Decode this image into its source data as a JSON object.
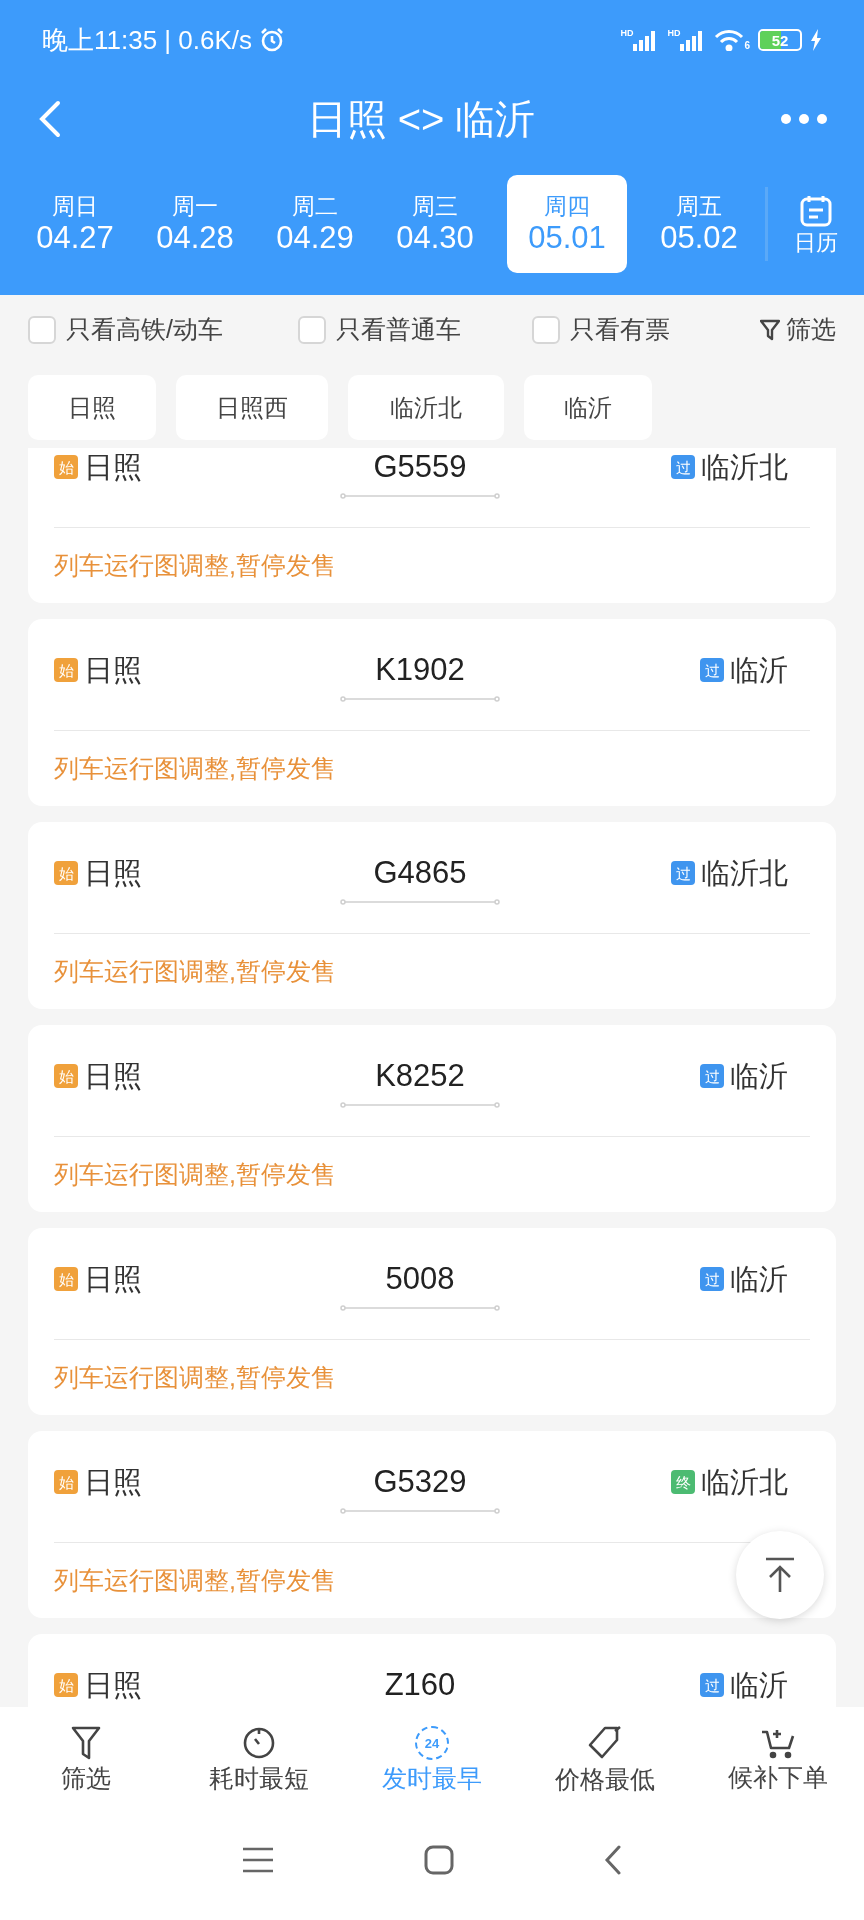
{
  "status_bar": {
    "time": "晚上11:35 | 0.6K/s",
    "signals": [
      {
        "label": "HD"
      },
      {
        "label": "HD"
      }
    ],
    "wifi_label": "6",
    "battery": "52"
  },
  "header": {
    "title": "日照 <> 临沂"
  },
  "dates": [
    {
      "weekday": "周日",
      "date": "04.27",
      "selected": false
    },
    {
      "weekday": "周一",
      "date": "04.28",
      "selected": false
    },
    {
      "weekday": "周二",
      "date": "04.29",
      "selected": false
    },
    {
      "weekday": "周三",
      "date": "04.30",
      "selected": false
    },
    {
      "weekday": "周四",
      "date": "05.01",
      "selected": true
    },
    {
      "weekday": "周五",
      "date": "05.02",
      "selected": false
    }
  ],
  "calendar_button": "日历",
  "filters": [
    {
      "label": "只看高铁/动车",
      "checked": false
    },
    {
      "label": "只看普通车",
      "checked": false
    },
    {
      "label": "只看有票",
      "checked": false
    }
  ],
  "filter_button": "筛选",
  "stations": [
    "日照",
    "日照西",
    "临沂北",
    "临沂"
  ],
  "trains": [
    {
      "from_badge": {
        "text": "始",
        "color": "#f0a13b"
      },
      "from": "日照",
      "number": "G5559",
      "to_badge": {
        "text": "过",
        "color": "#3f95ef"
      },
      "to": "临沂北",
      "status": "列车运行图调整,暂停发售"
    },
    {
      "from_badge": {
        "text": "始",
        "color": "#f0a13b"
      },
      "from": "日照",
      "number": "K1902",
      "to_badge": {
        "text": "过",
        "color": "#3f95ef"
      },
      "to": "临沂",
      "status": "列车运行图调整,暂停发售"
    },
    {
      "from_badge": {
        "text": "始",
        "color": "#f0a13b"
      },
      "from": "日照",
      "number": "G4865",
      "to_badge": {
        "text": "过",
        "color": "#3f95ef"
      },
      "to": "临沂北",
      "status": "列车运行图调整,暂停发售"
    },
    {
      "from_badge": {
        "text": "始",
        "color": "#f0a13b"
      },
      "from": "日照",
      "number": "K8252",
      "to_badge": {
        "text": "过",
        "color": "#3f95ef"
      },
      "to": "临沂",
      "status": "列车运行图调整,暂停发售"
    },
    {
      "from_badge": {
        "text": "始",
        "color": "#f0a13b"
      },
      "from": "日照",
      "number": "5008",
      "to_badge": {
        "text": "过",
        "color": "#3f95ef"
      },
      "to": "临沂",
      "status": "列车运行图调整,暂停发售"
    },
    {
      "from_badge": {
        "text": "始",
        "color": "#f0a13b"
      },
      "from": "日照",
      "number": "G5329",
      "to_badge": {
        "text": "终",
        "color": "#4cbb72"
      },
      "to": "临沂北",
      "status": "列车运行图调整,暂停发售"
    },
    {
      "from_badge": {
        "text": "始",
        "color": "#f0a13b"
      },
      "from": "日照",
      "number": "Z160",
      "to_badge": {
        "text": "过",
        "color": "#3f95ef"
      },
      "to": "临沂"
    }
  ],
  "bottom_nav": [
    {
      "kind": "filter",
      "label": "筛选",
      "selected": false
    },
    {
      "kind": "timer",
      "label": "耗时最短",
      "selected": false
    },
    {
      "kind": "clock24",
      "icon_text": "24",
      "label": "发时最早",
      "selected": true
    },
    {
      "kind": "tag",
      "label": "价格最低",
      "selected": false
    },
    {
      "kind": "cart",
      "label": "候补下单",
      "selected": false
    }
  ]
}
